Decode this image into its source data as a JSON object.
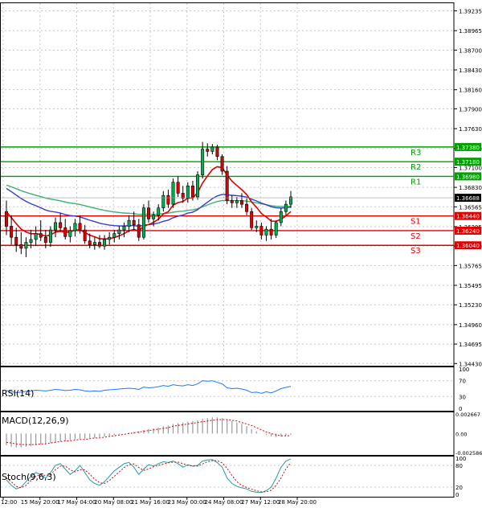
{
  "chart_data": {
    "type": "candlestick",
    "price_axis": {
      "ticks": [
        1.39235,
        1.38965,
        1.387,
        1.3843,
        1.3816,
        1.379,
        1.3763,
        1.3736,
        1.371,
        1.3683,
        1.36565,
        1.36295,
        1.3603,
        1.35765,
        1.35495,
        1.3523,
        1.3496,
        1.34695,
        1.3443
      ],
      "tick_labels": [
        "1.39235",
        "1.38965",
        "1.38700",
        "1.38430",
        "1.38160",
        "1.37900",
        "1.37630",
        "1.37360",
        "1.37100",
        "1.36830",
        "1.36565",
        "1.36295",
        "1.36030",
        "1.35765",
        "1.35495",
        "1.35230",
        "1.34960",
        "1.34695",
        "1.34430"
      ],
      "range": [
        1.344,
        1.3935
      ]
    },
    "time_axis": {
      "labels": [
        "12:00",
        "15 May 20:00",
        "17 May 04:00",
        "20 May 08:00",
        "21 May 16:00",
        "23 May 00:00",
        "24 May 08:00",
        "27 May 12:00",
        "28 May 20:00"
      ]
    },
    "levels": [
      {
        "name": "R3",
        "value": 1.3738,
        "label": "1.37380",
        "color": "#00a000"
      },
      {
        "name": "R2",
        "value": 1.3718,
        "label": "1.37180",
        "color": "#00a000"
      },
      {
        "name": "R1",
        "value": 1.3698,
        "label": "1.36980",
        "color": "#00a000"
      },
      {
        "name": "S1",
        "value": 1.3644,
        "label": "1.36440",
        "color": "#e00000"
      },
      {
        "name": "S2",
        "value": 1.3624,
        "label": "1.36240",
        "color": "#e00000"
      },
      {
        "name": "S3",
        "value": 1.3604,
        "label": "1.36040",
        "color": "#e00000"
      }
    ],
    "current_price": {
      "value": 1.36688,
      "label": "1.36688"
    },
    "candles": [
      [
        1.365,
        1.3665,
        1.3618,
        1.363
      ],
      [
        1.363,
        1.3645,
        1.3605,
        1.3615
      ],
      [
        1.3615,
        1.3628,
        1.3595,
        1.3605
      ],
      [
        1.3605,
        1.3622,
        1.3592,
        1.36
      ],
      [
        1.36,
        1.3615,
        1.3588,
        1.3608
      ],
      [
        1.3608,
        1.3625,
        1.36,
        1.3612
      ],
      [
        1.3612,
        1.363,
        1.3603,
        1.362
      ],
      [
        1.362,
        1.3638,
        1.361,
        1.3615
      ],
      [
        1.3615,
        1.3625,
        1.36,
        1.3608
      ],
      [
        1.3608,
        1.363,
        1.3602,
        1.3625
      ],
      [
        1.3625,
        1.3642,
        1.3615,
        1.3635
      ],
      [
        1.3635,
        1.3648,
        1.3622,
        1.3628
      ],
      [
        1.3628,
        1.364,
        1.3612,
        1.3616
      ],
      [
        1.3616,
        1.363,
        1.3608,
        1.3624
      ],
      [
        1.3624,
        1.364,
        1.3616,
        1.3634
      ],
      [
        1.3634,
        1.3645,
        1.362,
        1.3625
      ],
      [
        1.3625,
        1.3632,
        1.3606,
        1.361
      ],
      [
        1.361,
        1.362,
        1.36,
        1.3605
      ],
      [
        1.3605,
        1.3615,
        1.3598,
        1.3608
      ],
      [
        1.3608,
        1.3618,
        1.36,
        1.3603
      ],
      [
        1.3603,
        1.3618,
        1.3598,
        1.3612
      ],
      [
        1.3612,
        1.3622,
        1.3605,
        1.3615
      ],
      [
        1.3615,
        1.3625,
        1.3608,
        1.362
      ],
      [
        1.362,
        1.363,
        1.3612,
        1.3625
      ],
      [
        1.3625,
        1.3635,
        1.3615,
        1.363
      ],
      [
        1.363,
        1.3645,
        1.3622,
        1.3638
      ],
      [
        1.3638,
        1.365,
        1.3625,
        1.3632
      ],
      [
        1.3632,
        1.364,
        1.361,
        1.3615
      ],
      [
        1.3615,
        1.366,
        1.3612,
        1.3655
      ],
      [
        1.3655,
        1.3665,
        1.3635,
        1.364
      ],
      [
        1.364,
        1.365,
        1.363,
        1.3645
      ],
      [
        1.3645,
        1.366,
        1.3638,
        1.3655
      ],
      [
        1.3655,
        1.3678,
        1.365,
        1.3672
      ],
      [
        1.3672,
        1.368,
        1.3655,
        1.366
      ],
      [
        1.366,
        1.3695,
        1.3655,
        1.369
      ],
      [
        1.369,
        1.3698,
        1.367,
        1.3675
      ],
      [
        1.3675,
        1.3685,
        1.3662,
        1.3668
      ],
      [
        1.3668,
        1.369,
        1.3662,
        1.3685
      ],
      [
        1.3685,
        1.3692,
        1.3665,
        1.367
      ],
      [
        1.367,
        1.3705,
        1.3666,
        1.37
      ],
      [
        1.37,
        1.3745,
        1.3695,
        1.3735
      ],
      [
        1.3735,
        1.3743,
        1.3725,
        1.3732
      ],
      [
        1.3732,
        1.3742,
        1.3728,
        1.3738
      ],
      [
        1.3738,
        1.3741,
        1.372,
        1.3725
      ],
      [
        1.3725,
        1.3728,
        1.37,
        1.3705
      ],
      [
        1.3705,
        1.3712,
        1.366,
        1.3665
      ],
      [
        1.3665,
        1.3672,
        1.3655,
        1.3662
      ],
      [
        1.3662,
        1.367,
        1.3655,
        1.3665
      ],
      [
        1.3665,
        1.3675,
        1.3655,
        1.366
      ],
      [
        1.366,
        1.3668,
        1.3645,
        1.365
      ],
      [
        1.365,
        1.3655,
        1.3625,
        1.3628
      ],
      [
        1.3628,
        1.3638,
        1.3622,
        1.363
      ],
      [
        1.363,
        1.3635,
        1.3612,
        1.3618
      ],
      [
        1.3618,
        1.363,
        1.361,
        1.3626
      ],
      [
        1.3626,
        1.364,
        1.3612,
        1.3618
      ],
      [
        1.3618,
        1.3638,
        1.3614,
        1.3635
      ],
      [
        1.3635,
        1.3655,
        1.363,
        1.365
      ],
      [
        1.365,
        1.3665,
        1.3645,
        1.366
      ],
      [
        1.366,
        1.3678,
        1.3655,
        1.367
      ]
    ],
    "indicators": [
      {
        "name": "RSI(14)",
        "label": "RSI(14)",
        "scale_labels": [
          "100",
          "70",
          "30",
          "0"
        ],
        "color": "#1e78ff",
        "values": [
          45,
          42,
          40,
          41,
          43,
          44,
          46,
          45,
          44,
          46,
          48,
          47,
          45,
          46,
          48,
          47,
          44,
          43,
          44,
          43,
          46,
          47,
          48,
          49,
          50,
          51,
          50,
          48,
          54,
          52,
          53,
          55,
          58,
          56,
          60,
          58,
          57,
          60,
          58,
          62,
          70,
          69,
          70,
          66,
          62,
          52,
          50,
          51,
          49,
          46,
          40,
          41,
          38,
          42,
          39,
          44,
          50,
          53,
          56
        ]
      },
      {
        "name": "MACD(12,26,9)",
        "label": "MACD(12,26,9)",
        "scale_labels": [
          "0.002667",
          "0.00",
          "-0.002586"
        ],
        "color": "#e00000",
        "histogram": [
          -0.0016,
          -0.0018,
          -0.0019,
          -0.0019,
          -0.0018,
          -0.0017,
          -0.0016,
          -0.0015,
          -0.0014,
          -0.0013,
          -0.0012,
          -0.0011,
          -0.001,
          -0.0009,
          -0.0008,
          -0.0007,
          -0.0007,
          -0.0006,
          -0.0006,
          -0.0005,
          -0.0004,
          -0.0003,
          -0.0002,
          -0.0001,
          0.0,
          0.0001,
          0.0002,
          0.0003,
          0.0005,
          0.0006,
          0.0007,
          0.0008,
          0.001,
          0.0011,
          0.0013,
          0.0014,
          0.0015,
          0.0016,
          0.0017,
          0.0018,
          0.002,
          0.0021,
          0.0022,
          0.0022,
          0.0021,
          0.0019,
          0.0017,
          0.0015,
          0.0013,
          0.001,
          0.0006,
          0.0003,
          0.0,
          -0.0002,
          -0.0004,
          -0.0005,
          -0.0004,
          -0.0003,
          -0.0002
        ],
        "signal": [
          -0.0012,
          -0.0013,
          -0.0014,
          -0.0015,
          -0.0015,
          -0.0015,
          -0.0015,
          -0.0014,
          -0.0014,
          -0.0013,
          -0.0012,
          -0.0011,
          -0.001,
          -0.001,
          -0.0009,
          -0.0008,
          -0.0008,
          -0.0007,
          -0.0006,
          -0.0006,
          -0.0005,
          -0.0004,
          -0.0003,
          -0.0002,
          -0.0001,
          0.0,
          0.0001,
          0.0002,
          0.0003,
          0.0004,
          0.0005,
          0.0006,
          0.0007,
          0.0008,
          0.001,
          0.0011,
          0.0012,
          0.0013,
          0.0014,
          0.0015,
          0.0016,
          0.0017,
          0.0018,
          0.0019,
          0.0019,
          0.0019,
          0.0018,
          0.0017,
          0.0015,
          0.0013,
          0.0011,
          0.0008,
          0.0005,
          0.0002,
          0.0,
          -0.0002,
          -0.0003,
          -0.0003,
          -0.0003
        ]
      },
      {
        "name": "Stoch(9,6,3)",
        "label": "Stoch(9,6,3)",
        "scale_labels": [
          "100",
          "80",
          "20",
          "0"
        ],
        "colors": [
          "#1ea0a0",
          "#e00000"
        ],
        "main": [
          40,
          25,
          15,
          20,
          35,
          50,
          60,
          55,
          45,
          60,
          80,
          85,
          70,
          55,
          65,
          80,
          60,
          40,
          30,
          25,
          35,
          50,
          65,
          75,
          85,
          88,
          75,
          55,
          70,
          82,
          78,
          85,
          90,
          88,
          92,
          85,
          75,
          82,
          78,
          80,
          92,
          95,
          96,
          88,
          75,
          45,
          30,
          22,
          18,
          15,
          8,
          6,
          5,
          10,
          20,
          45,
          75,
          92,
          98
        ],
        "signal": [
          45,
          35,
          22,
          18,
          25,
          38,
          50,
          55,
          52,
          55,
          68,
          78,
          78,
          68,
          62,
          68,
          68,
          55,
          42,
          32,
          30,
          38,
          50,
          62,
          74,
          82,
          84,
          74,
          66,
          70,
          76,
          80,
          84,
          87,
          89,
          89,
          85,
          80,
          78,
          78,
          84,
          90,
          93,
          93,
          87,
          72,
          52,
          35,
          25,
          19,
          14,
          10,
          7,
          7,
          11,
          25,
          45,
          70,
          88
        ]
      }
    ]
  }
}
